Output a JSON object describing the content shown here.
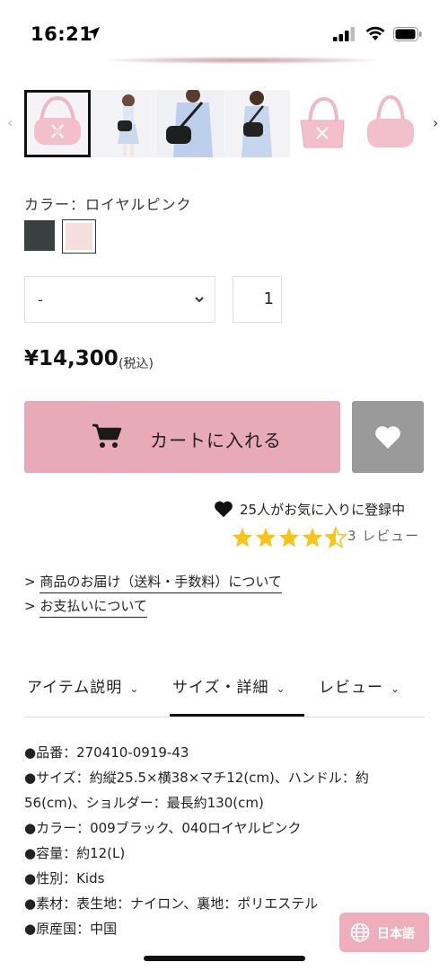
{
  "status_bar": {
    "time": "16:21"
  },
  "colors": {
    "accent_pink": "#e8aab7",
    "fav_gray": "#9a9a9a",
    "star": "#f5c518",
    "lang_pink": "#eeaab9"
  },
  "thumbnails": [
    {
      "name": "pink-bag-front",
      "selected": true
    },
    {
      "name": "child-carrying-black-bag",
      "selected": false
    },
    {
      "name": "adult-carrying-black-bag",
      "selected": false
    },
    {
      "name": "child-carrying-bag-front",
      "selected": false
    },
    {
      "name": "pink-bag-angle",
      "selected": false
    },
    {
      "name": "pink-bag-side",
      "selected": false
    }
  ],
  "product": {
    "color_label": "カラー：ロイヤルピンク",
    "swatches": [
      {
        "name": "black",
        "color": "#3a3f40"
      },
      {
        "name": "royal-pink",
        "color": "#f5dede"
      }
    ],
    "size_select_value": "-",
    "quantity": "1",
    "price": "¥14,300",
    "tax_note": "(税込)",
    "cart_label": "カートに入れる",
    "favorites_text": "25人がお気に入りに登録中",
    "rating": 4.5,
    "review_count": "3 レビュー"
  },
  "links": {
    "delivery": "商品のお届け（送料・手数料）について",
    "payment": "お支払いについて",
    "prefix": ">"
  },
  "tabs": [
    {
      "label": "アイテム説明",
      "active": false
    },
    {
      "label": "サイズ・詳細",
      "active": true
    },
    {
      "label": "レビュー",
      "active": false
    }
  ],
  "details": [
    "●品番：270410-0919-43",
    "●サイズ：約縦25.5×横38×マチ12(cm)、ハンドル：約56(cm)、ショルダー：最長約130(cm)",
    "●カラー：009ブラック、040ロイヤルピンク",
    "●容量：約12(L)",
    "●性別：Kids",
    "●素材：表生地：ナイロン、裏地：ポリエステル",
    "●原産国：中国"
  ],
  "language_button": "日本語"
}
